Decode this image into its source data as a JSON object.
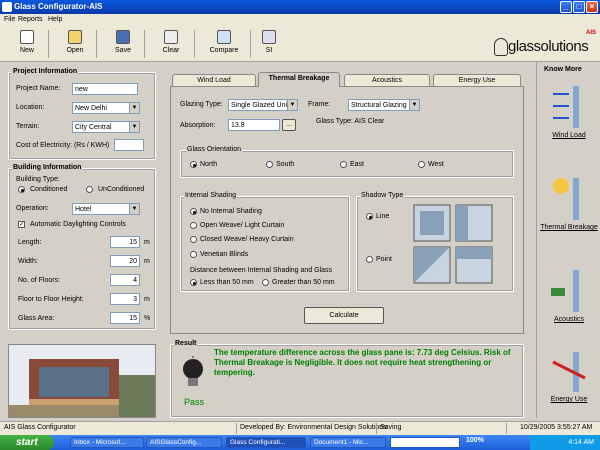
{
  "window": {
    "title": "Glass Configurator-AIS"
  },
  "menu": [
    "File",
    "Reports",
    "Help"
  ],
  "toolbar": {
    "new": "New",
    "open": "Open",
    "save": "Save",
    "clear": "Clear",
    "compare": "Compare",
    "si": "SI"
  },
  "logo": {
    "brand": "glassolutions",
    "badge": "AIS"
  },
  "project": {
    "title": "Project Information",
    "name_label": "Project Name:",
    "name_value": "new",
    "location_label": "Location:",
    "location_value": "New Delhi",
    "terrain_label": "Terrain:",
    "terrain_value": "City Central",
    "cost_label": "Cost of Electricity: (Rs / KWH)",
    "cost_value": ""
  },
  "building": {
    "title": "Building Information",
    "type_label": "Building Type:",
    "conditioned": "Conditioned",
    "unconditioned": "UnConditioned",
    "operation_label": "Operation:",
    "operation_value": "Hotel",
    "daylighting": "Automatic Daylighting Controls",
    "length_label": "Length:",
    "length_value": "15",
    "length_unit": "m",
    "width_label": "Width:",
    "width_value": "20",
    "width_unit": "m",
    "floors_label": "No. of Floors:",
    "floors_value": "4",
    "height_label": "Floor to Floor Height:",
    "height_value": "3",
    "height_unit": "m",
    "glass_label": "Glass Area:",
    "glass_value": "15",
    "glass_unit": "%"
  },
  "tabs": [
    "Wind Load",
    "Thermal Breakage",
    "Acoustics",
    "Energy Use"
  ],
  "thermal": {
    "glazing_label": "Glazing Type:",
    "glazing_value": "Single Glazed Unit",
    "frame_label": "Frame:",
    "frame_value": "Structural Glazing",
    "absorption_label": "Absorption:",
    "absorption_value": "13.8",
    "browse": "...",
    "glass_type": "Glass Type: AIS Clear",
    "orientation_title": "Glass Orientation",
    "north": "North",
    "south": "South",
    "east": "East",
    "west": "West",
    "shading_title": "Internal Shading",
    "no_shading": "No Internal Shading",
    "open_weave": "Open Weave/ Light Curtain",
    "closed_weave": "Closed Weave/ Heavy Curtain",
    "venetian": "Venetian Blinds",
    "distance_label": "Distance between Internal Shading and Glass",
    "less50": "Less than 50 mm",
    "greater50": "Greater than 50 mm",
    "shadow_title": "Shadow Type",
    "line": "Line",
    "point": "Point",
    "calculate": "Calculate"
  },
  "result": {
    "title": "Result",
    "message": "The temperature difference across the glass pane is: 7.73 deg Celsius. Risk of Thermal Breakage is Negligible. It does not require heat strengthening or tempering.",
    "status": "Pass",
    "status_color": "#008000"
  },
  "know_more": {
    "title": "Know More",
    "items": [
      "Wind Load",
      "Thermal Breakage",
      "Acoustics",
      "Energy Use"
    ]
  },
  "status_bar": {
    "app": "AIS Glass Configurator",
    "developer": "Developed By: Environmental Design Solutions",
    "state": "Saving",
    "datetime": "10/29/2005 3:55:27 AM"
  },
  "taskbar": {
    "start": "start",
    "tasks": [
      "Inbox - Microsof...",
      "AISGlassConfig...",
      "Glass Configurati...",
      "Document1 - Mic..."
    ],
    "zoom": "100%",
    "clock": "4:14 AM"
  }
}
